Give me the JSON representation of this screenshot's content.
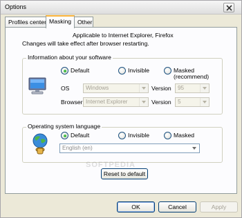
{
  "window": {
    "title": "Options"
  },
  "tabs": [
    {
      "label": "Profiles center"
    },
    {
      "label": "Masking"
    },
    {
      "label": "Other"
    }
  ],
  "intro": {
    "line1": "Applicable to Internet Explorer, Firefox",
    "line2": "Changes will take effect after browser restarting."
  },
  "software_group": {
    "legend": "Information about your software",
    "radios": [
      {
        "label": "Default",
        "checked": true
      },
      {
        "label": "Invisible",
        "checked": false
      },
      {
        "label": "Masked",
        "sublabel": "(recommend)",
        "checked": false
      }
    ],
    "os_label": "OS",
    "os_value": "Windows",
    "os_version_label": "Version",
    "os_version_value": "95",
    "browser_label": "Browser",
    "browser_value": "Internet Explorer",
    "browser_version_label": "Version",
    "browser_version_value": "5"
  },
  "language_group": {
    "legend": "Operating system language",
    "radios": [
      {
        "label": "Default",
        "checked": true
      },
      {
        "label": "Invisible",
        "checked": false
      },
      {
        "label": "Masked",
        "checked": false
      }
    ],
    "language_value": "English (en)"
  },
  "reset_button": "Reset to default",
  "buttons": {
    "ok": "OK",
    "cancel": "Cancel",
    "apply": "Apply"
  },
  "watermark": "SOFTPEDIA",
  "icons": {
    "software": "computer-monitor-icon",
    "language": "globe-person-icon",
    "close": "close-icon"
  },
  "colors": {
    "face": "#ece9d8",
    "panel": "#fcfcfe",
    "tab_highlight": "#f9b23b",
    "radio_checked": "#21a121",
    "button_border": "#003c74"
  }
}
